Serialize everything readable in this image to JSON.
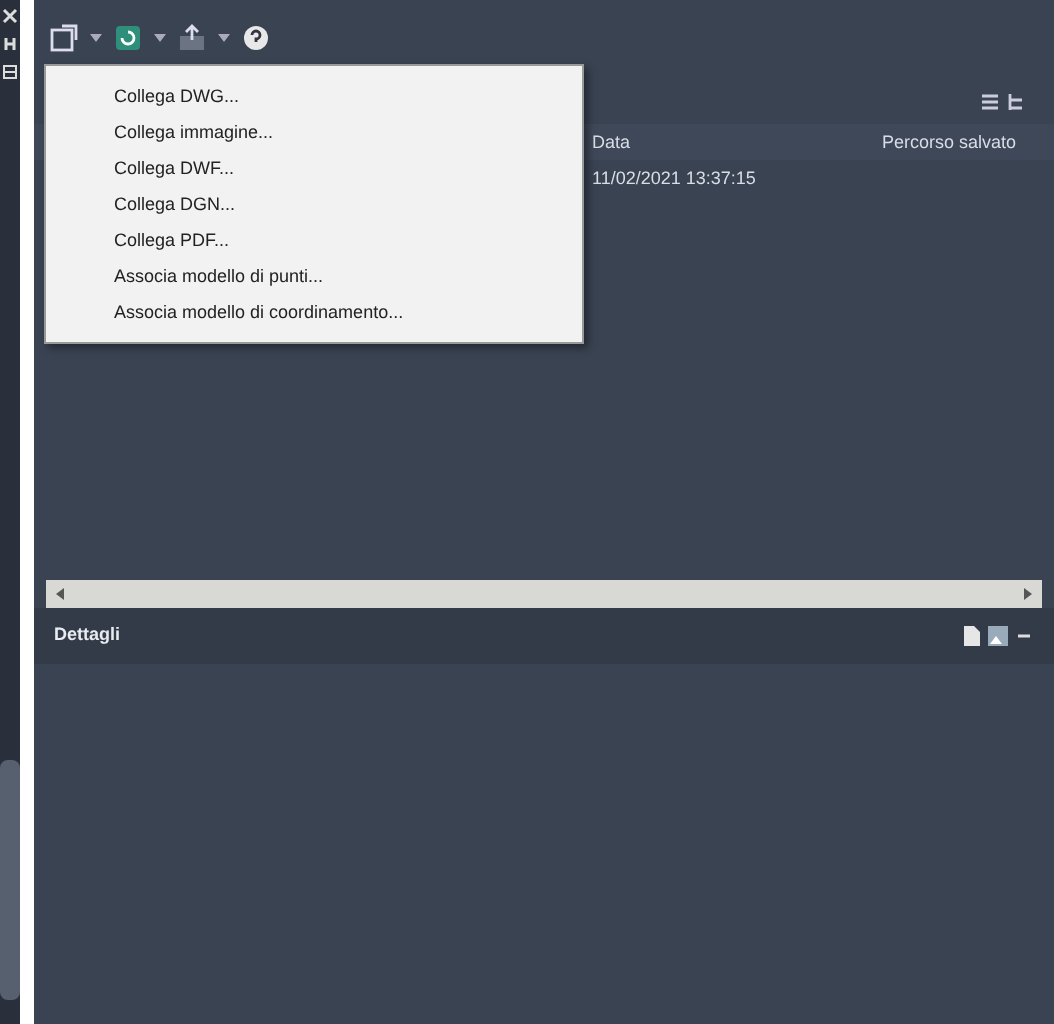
{
  "toolbar": {
    "buttons": [
      {
        "kind": "attach"
      },
      {
        "kind": "refresh"
      },
      {
        "kind": "upload"
      },
      {
        "kind": "help"
      }
    ]
  },
  "menu": {
    "items": [
      {
        "label": "Collega DWG..."
      },
      {
        "label": "Collega immagine..."
      },
      {
        "label": "Collega DWF..."
      },
      {
        "label": "Collega DGN..."
      },
      {
        "label": "Collega PDF..."
      },
      {
        "label": "Associa modello di punti..."
      },
      {
        "label": "Associa modello di coordinamento..."
      }
    ]
  },
  "file_references": {
    "columns": [
      "Data",
      "Percorso salvato"
    ],
    "rows": [
      [
        "11/02/2021 13:37:15"
      ]
    ]
  },
  "details": {
    "title": "Dettagli"
  }
}
